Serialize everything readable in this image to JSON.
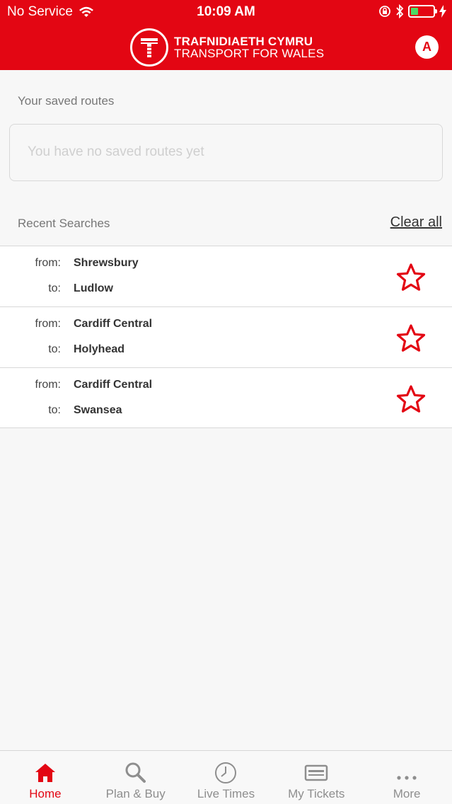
{
  "status_bar": {
    "carrier": "No Service",
    "time": "10:09 AM"
  },
  "header": {
    "logo_line1": "TRAFNIDIAETH CYMRU",
    "logo_line2": "TRANSPORT FOR WALES",
    "account_initial": "A"
  },
  "saved": {
    "title": "Your saved routes",
    "empty_text": "You have no saved routes yet"
  },
  "recent": {
    "title": "Recent Searches",
    "clear_label": "Clear all",
    "from_label": "from:",
    "to_label": "to:",
    "items": [
      {
        "from": "Shrewsbury",
        "to": "Ludlow"
      },
      {
        "from": "Cardiff Central",
        "to": "Holyhead"
      },
      {
        "from": "Cardiff Central",
        "to": "Swansea"
      }
    ]
  },
  "tabs": [
    {
      "label": "Home",
      "icon": "home-icon",
      "active": true
    },
    {
      "label": "Plan & Buy",
      "icon": "search-icon",
      "active": false
    },
    {
      "label": "Live Times",
      "icon": "clock-icon",
      "active": false
    },
    {
      "label": "My Tickets",
      "icon": "ticket-icon",
      "active": false
    },
    {
      "label": "More",
      "icon": "more-icon",
      "active": false
    }
  ],
  "colors": {
    "brand_red": "#e30613",
    "battery_green": "#4cd964"
  }
}
